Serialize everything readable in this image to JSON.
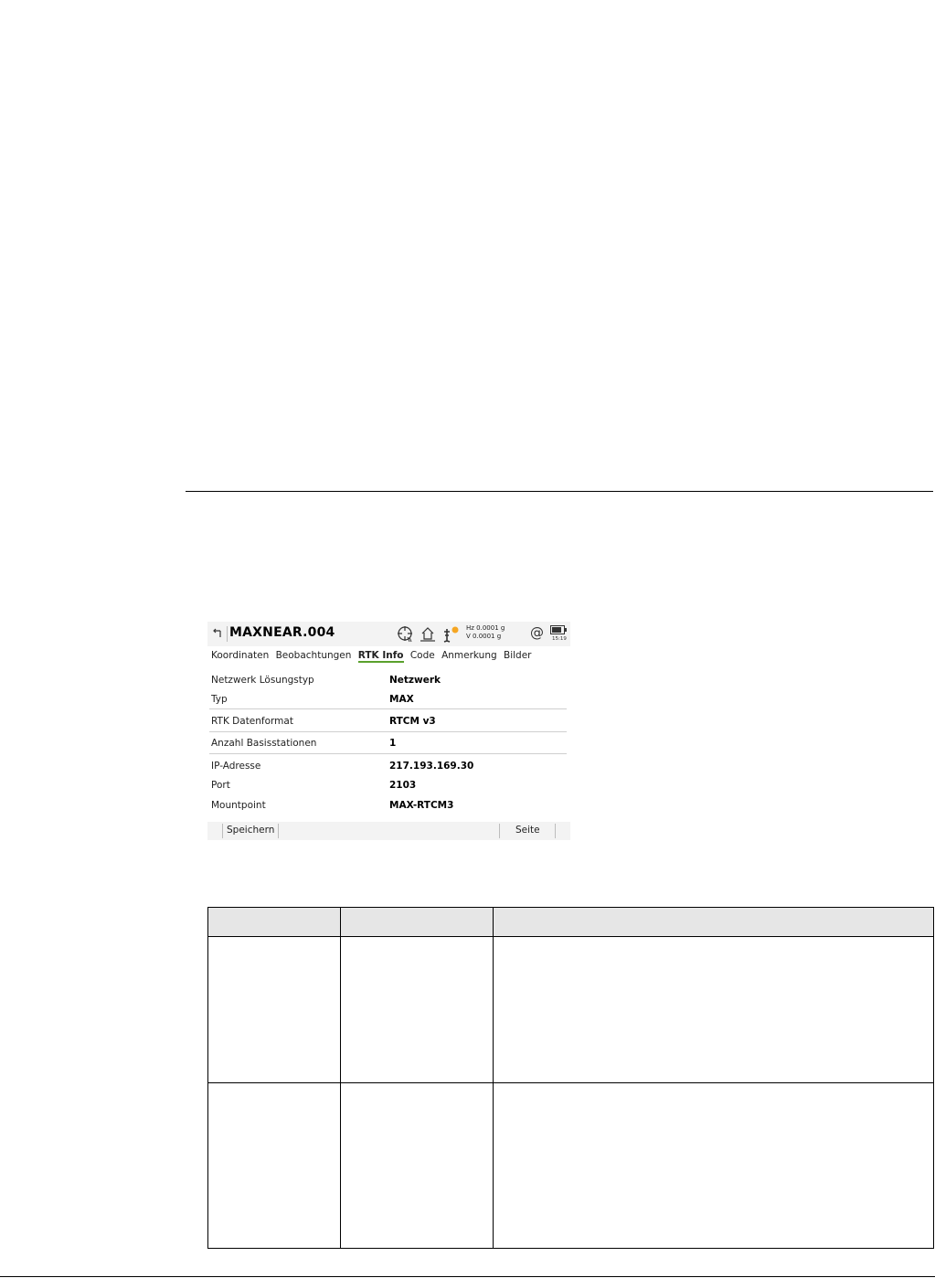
{
  "screen": {
    "job_title": "MAXNEAR.004",
    "angles": {
      "hz": "Hz 0.0001 g",
      "v": "V   0.0001 g"
    },
    "at_symbol": "@",
    "time": "15:19",
    "icons": [
      "back-arrow-icon",
      "target-icon",
      "house-icon",
      "satellite-icon",
      "battery-icon"
    ],
    "accent_color": "#5aa02c",
    "tabs": [
      {
        "label": "Koordinaten",
        "active": false
      },
      {
        "label": "Beobachtungen",
        "active": false
      },
      {
        "label": "RTK Info",
        "active": true
      },
      {
        "label": "Code",
        "active": false
      },
      {
        "label": "Anmerkung",
        "active": false
      },
      {
        "label": "Bilder",
        "active": false
      }
    ],
    "fields": [
      {
        "label": "Netzwerk Lösungstyp",
        "value": "Netzwerk"
      },
      {
        "label": "Typ",
        "value": "MAX"
      },
      {
        "label": "RTK Datenformat",
        "value": "RTCM v3"
      },
      {
        "label": "Anzahl Basisstationen",
        "value": "1"
      },
      {
        "label": "IP-Adresse",
        "value": "217.193.169.30"
      },
      {
        "label": "Port",
        "value": "2103"
      },
      {
        "label": "Mountpoint",
        "value": "MAX-RTCM3"
      }
    ],
    "softkeys": {
      "save": "Speichern",
      "page": "Seite"
    }
  },
  "table": {
    "header": [
      "",
      "",
      ""
    ],
    "rows": [
      [
        "",
        "",
        ""
      ],
      [
        "",
        "",
        ""
      ]
    ]
  }
}
